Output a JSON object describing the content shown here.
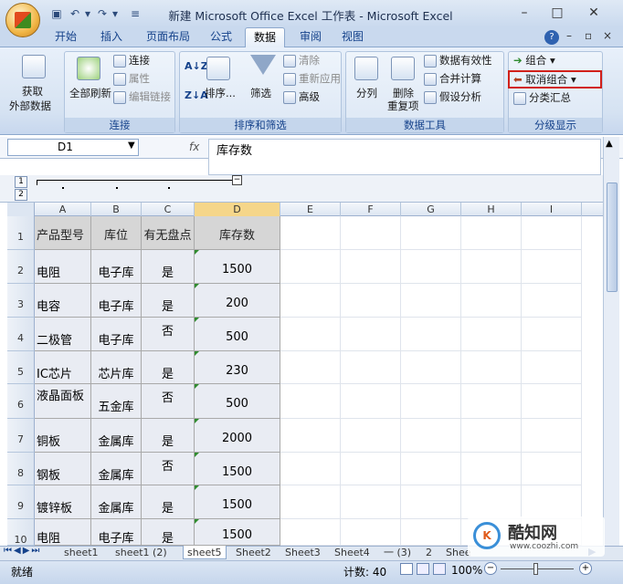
{
  "window": {
    "title": "新建 Microsoft Office Excel 工作表 - Microsoft Excel",
    "controls": [
      "–",
      "□",
      "✕"
    ]
  },
  "tabs": [
    {
      "label": "开始",
      "active": false
    },
    {
      "label": "插入",
      "active": false
    },
    {
      "label": "页面布局",
      "active": false
    },
    {
      "label": "公式",
      "active": false
    },
    {
      "label": "数据",
      "active": true
    },
    {
      "label": "审阅",
      "active": false
    },
    {
      "label": "视图",
      "active": false
    }
  ],
  "ribbon": {
    "get_external": {
      "line1": "获取",
      "line2": "外部数据"
    },
    "connections": {
      "refresh_all": "全部刷新",
      "connect": "连接",
      "properties": "属性",
      "edit_links": "编辑链接",
      "label": "连接"
    },
    "sort_filter": {
      "sort": "排序...",
      "filter": "筛选",
      "clear": "清除",
      "reapply": "重新应用",
      "advanced": "高级",
      "label": "排序和筛选"
    },
    "data_tools": {
      "text_to_columns": "分列",
      "remove_dup_line1": "删除",
      "remove_dup_line2": "重复项",
      "validation": "数据有效性",
      "consolidate": "合并计算",
      "what_if": "假设分析",
      "label": "数据工具"
    },
    "outline": {
      "group": "组合",
      "ungroup": "取消组合",
      "subtotal": "分类汇总",
      "label": "分级显示"
    }
  },
  "formula_bar": {
    "name_box": "D1",
    "fx": "fx",
    "content": "库存数"
  },
  "outline_levels": [
    "1",
    "2"
  ],
  "columns": [
    "A",
    "B",
    "C",
    "D",
    "E",
    "F",
    "G",
    "H",
    "I"
  ],
  "rows": [
    {
      "num": "1",
      "cells": [
        "产品型号",
        "库位",
        "有无盘点",
        "库存数"
      ]
    },
    {
      "num": "2",
      "cells": [
        "电阻",
        "电子库",
        "是",
        "1500"
      ]
    },
    {
      "num": "3",
      "cells": [
        "电容",
        "电子库",
        "是",
        "200"
      ]
    },
    {
      "num": "4",
      "cells": [
        "二极管",
        "电子库",
        "否",
        "500"
      ]
    },
    {
      "num": "5",
      "cells": [
        "IC芯片",
        "芯片库",
        "是",
        "230"
      ]
    },
    {
      "num": "6",
      "cells": [
        "液晶面板",
        "五金库",
        "否",
        "500"
      ]
    },
    {
      "num": "7",
      "cells": [
        "铜板",
        "金属库",
        "是",
        "2000"
      ]
    },
    {
      "num": "8",
      "cells": [
        "钢板",
        "金属库",
        "否",
        "1500"
      ]
    },
    {
      "num": "9",
      "cells": [
        "镀锌板",
        "金属库",
        "是",
        "1500"
      ]
    },
    {
      "num": "10",
      "cells": [
        "电阻",
        "电子库",
        "是",
        "1500"
      ]
    }
  ],
  "sheets": [
    {
      "label": "sheet1",
      "active": false
    },
    {
      "label": "sheet1 (2)",
      "active": false
    },
    {
      "label": "sheet5",
      "active": true
    },
    {
      "label": "Sheet2",
      "active": false
    },
    {
      "label": "Sheet3",
      "active": false
    },
    {
      "label": "Sheet4",
      "active": false
    },
    {
      "label": "一 (3)",
      "active": false
    },
    {
      "label": "2",
      "active": false
    },
    {
      "label": "Shee",
      "active": false
    }
  ],
  "status": {
    "mode": "就绪",
    "count": "计数: 40",
    "zoom": "100%"
  },
  "watermark": {
    "brand": "酷知网",
    "url": "www.coozhi.com"
  },
  "colors": {
    "highlight": "#d1201a",
    "accent": "#15428b"
  }
}
